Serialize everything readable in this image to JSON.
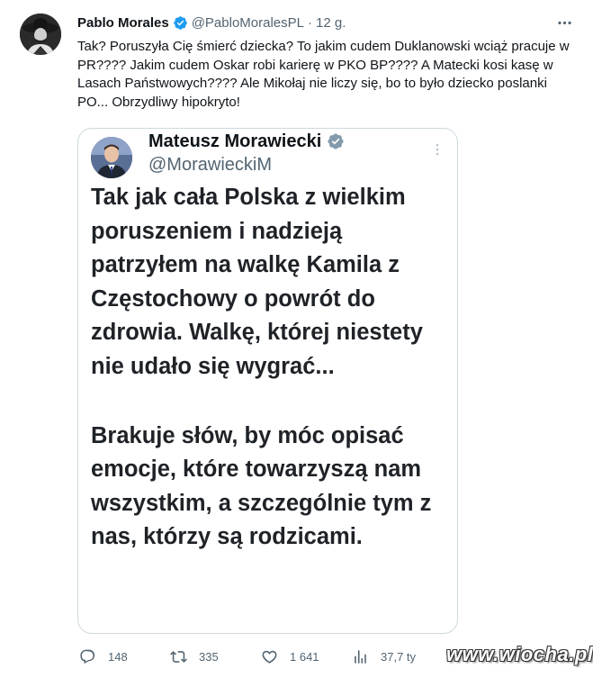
{
  "tweet": {
    "author_name": "Pablo Morales",
    "handle": "@PabloMoralesPL",
    "separator": "·",
    "time": "12 g.",
    "text": "Tak? Poruszyła Cię śmierć dziecka? To jakim cudem Duklanowski wciąż pracuje w PR???? Jakim cudem Oskar robi karierę w PKO BP???? A Matecki kosi kasę w Lasach Państwowych???? Ale Mikołaj nie liczy się, bo to było dziecko poslanki PO... Obrzydliwy hipokryto!"
  },
  "quoted": {
    "author_name": "Mateusz Morawiecki",
    "handle": "@MorawieckiM",
    "paragraph_1": "Tak jak cała Polska z wielkim poruszeniem i nadzieją patrzyłem na walkę Kamila z Częstochowy o powrót do zdrowia. Walkę, której niestety nie udało się wygrać...",
    "paragraph_2": "Brakuje słów, by móc opisać emocje, które towarzyszą nam wszystkim, a szczególnie tym z nas, którzy są rodzicami."
  },
  "actions": {
    "replies": "148",
    "retweets": "335",
    "likes": "1 641",
    "views": "37,7 ty"
  },
  "watermark": "www.wiocha.pl",
  "colors": {
    "verified_blue": "#1d9bf0",
    "secondary_text": "#536471",
    "border": "#cfd9de"
  },
  "icons": [
    "more-icon",
    "verified-badge-icon",
    "reply-icon",
    "retweet-icon",
    "like-icon",
    "views-icon"
  ]
}
